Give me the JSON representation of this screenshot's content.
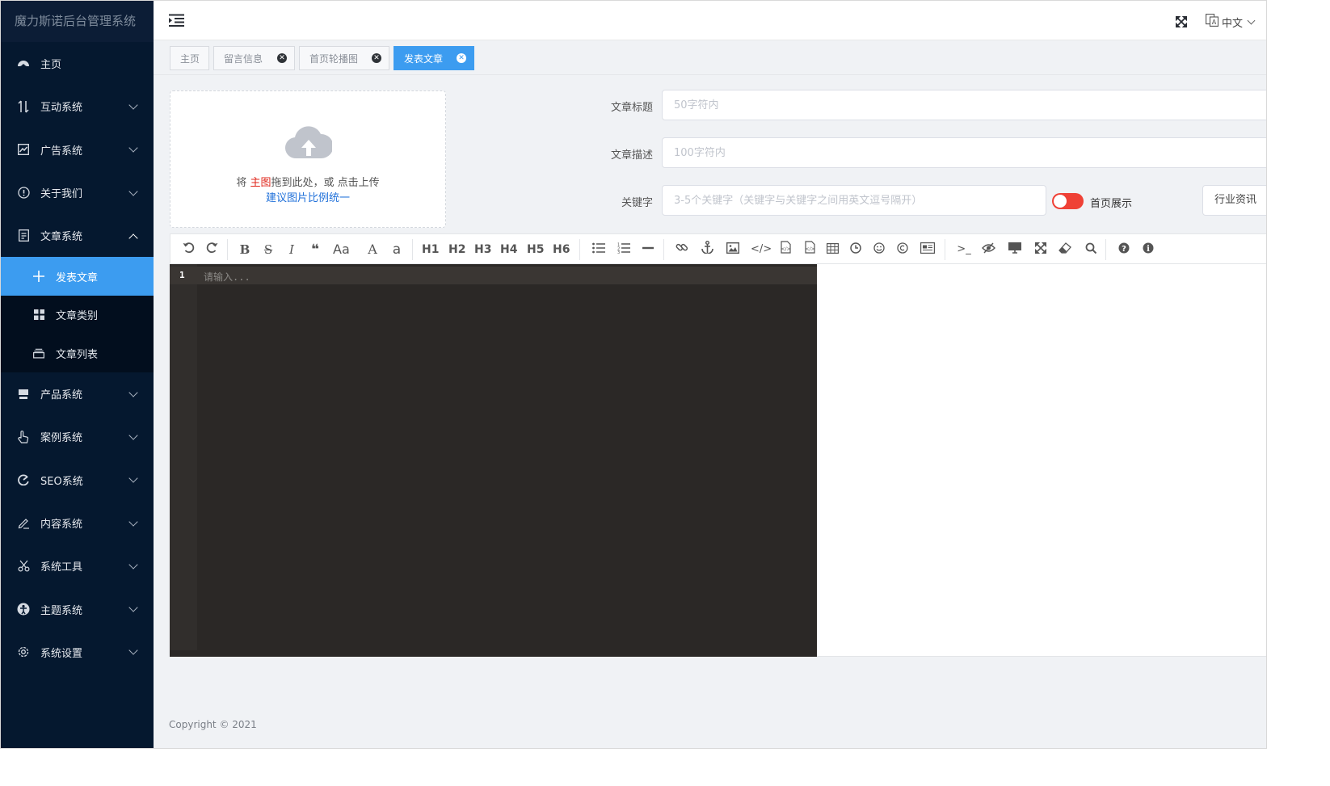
{
  "app": {
    "title": "魔力斯诺后台管理系统"
  },
  "sidebar": {
    "items": [
      {
        "label": "主页",
        "icon": "dashboard-icon"
      },
      {
        "label": "互动系统",
        "icon": "interaction-icon"
      },
      {
        "label": "广告系统",
        "icon": "chart-icon"
      },
      {
        "label": "关于我们",
        "icon": "info-circle-icon"
      },
      {
        "label": "文章系统",
        "icon": "document-icon"
      },
      {
        "label": "产品系统",
        "icon": "product-icon"
      },
      {
        "label": "案例系统",
        "icon": "hand-pointer-icon"
      },
      {
        "label": "SEO系统",
        "icon": "seo-icon"
      },
      {
        "label": "内容系统",
        "icon": "edit-icon"
      },
      {
        "label": "系统工具",
        "icon": "scissors-icon"
      },
      {
        "label": "主题系统",
        "icon": "theme-icon"
      },
      {
        "label": "系统设置",
        "icon": "gear-icon"
      }
    ],
    "submenu": [
      {
        "label": "发表文章",
        "icon": "plus-icon"
      },
      {
        "label": "文章类别",
        "icon": "grid-icon"
      },
      {
        "label": "文章列表",
        "icon": "list-box-icon"
      }
    ]
  },
  "header": {
    "language": "中文"
  },
  "tabs": [
    {
      "label": "主页"
    },
    {
      "label": "留言信息"
    },
    {
      "label": "首页轮播图"
    },
    {
      "label": "发表文章"
    }
  ],
  "upload": {
    "text_prefix": "将 ",
    "text_highlight": "主图",
    "text_suffix": "拖到此处，或 点击上传",
    "hint": "建议图片比例统一"
  },
  "form": {
    "title_label": "文章标题",
    "title_placeholder": "50字符内",
    "desc_label": "文章描述",
    "desc_placeholder": "100字符内",
    "keyword_label": "关键字",
    "keyword_placeholder": "3-5个关键字（关键字与关键字之间用英文逗号隔开）",
    "home_show_label": "首页展示",
    "category_value": "行业资讯"
  },
  "toolbar": {
    "headings": [
      "H1",
      "H2",
      "H3",
      "H4",
      "H5",
      "H6"
    ],
    "text_tools": [
      "B",
      "S",
      "I",
      "❝",
      "Aa",
      "A",
      "a"
    ]
  },
  "editor": {
    "line_number": "1",
    "placeholder": "请输入..."
  },
  "footer": {
    "copyright": "Copyright © 2021"
  },
  "colors": {
    "accent": "#3c9cf0",
    "sidebar": "#05182f",
    "switch_off": "#ef4136",
    "editor_bg": "#2b2826",
    "highlight_red": "#e0261b",
    "link_blue": "#1e6fd9"
  }
}
